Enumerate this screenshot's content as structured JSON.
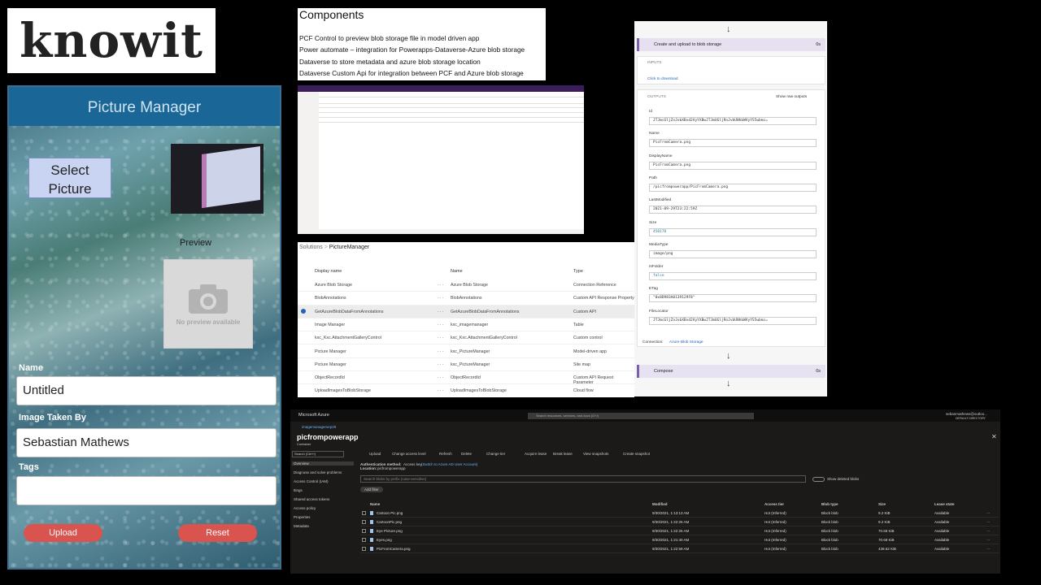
{
  "logo": {
    "text": "knowit"
  },
  "picture_manager": {
    "title": "Picture Manager",
    "select_button": "Select Picture",
    "preview_label": "Preview",
    "no_preview": "No preview available",
    "name_label": "Name",
    "name_value": "Untitled",
    "taken_by_label": "Image Taken By",
    "taken_by_value": "Sebastian Mathews",
    "tags_label": "Tags",
    "tags_value": "",
    "upload_button": "Upload",
    "reset_button": "Reset"
  },
  "components": {
    "title": "Components",
    "items": [
      "PCF Control to preview blob storage file in model driven app",
      "Power automate – integration for Powerapps-Dataverse-Azure blob storage",
      "Dataverse to store metadata and azure blob storage location",
      "Dataverse Custom Api for integration between PCF and Azure blob storage"
    ]
  },
  "solution": {
    "breadcrumb_root": "Solutions",
    "breadcrumb_current": "PictureManager",
    "headers": {
      "display": "Display name",
      "name": "Name",
      "type": "Type"
    },
    "rows": [
      {
        "display": "Azure Blob Storage",
        "name": "Azure Blob Storage",
        "type": "Connection Reference"
      },
      {
        "display": "BlobAnnotations",
        "name": "BlobAnnotations",
        "type": "Custom API Response Property"
      },
      {
        "display": "GetAzureBlobDataFromAnnotations",
        "name": "GetAzureBlobDataFromAnnotations",
        "type": "Custom API"
      },
      {
        "display": "Image Manager",
        "name": "kxc_imagemanager",
        "type": "Table"
      },
      {
        "display": "kxc_Kxc.AttachmentGalleryControl",
        "name": "kxc_Kxc.AttachmentGalleryControl",
        "type": "Custom control"
      },
      {
        "display": "Picture Manager",
        "name": "kxc_PictureManager",
        "type": "Model-driven app"
      },
      {
        "display": "Picture Manager",
        "name": "kxc_PictureManager",
        "type": "Site map"
      },
      {
        "display": "ObjectRecordId",
        "name": "ObjectRecordId",
        "type": "Custom API Request Parameter"
      },
      {
        "display": "UploadImagesToBlobStorage",
        "name": "UploadImagesToBlobStorage",
        "type": "Cloud flow"
      }
    ]
  },
  "flow": {
    "step_title": "Create and upload to blob storage",
    "step_time": "0s",
    "inputs_label": "INPUTS",
    "inputs_link": "Click to download",
    "outputs_label": "OUTPUTS",
    "show_raw": "Show raw outputs",
    "fields": [
      {
        "label": "Id",
        "value": "JTJmcGljZnJvbXBvd2VyYXBwJTJmUGljRnJvbUNhbWVyYS5wbmc="
      },
      {
        "label": "Name",
        "value": "PicFromCamera.png"
      },
      {
        "label": "DisplayName",
        "value": "PicFromCamera.png"
      },
      {
        "label": "Path",
        "value": "/picfrompowerapp/PicFromCamera.png"
      },
      {
        "label": "LastModified",
        "value": "2021-09-29T23:22:59Z"
      },
      {
        "label": "Size",
        "value": "450178"
      },
      {
        "label": "MediaType",
        "value": "image/png"
      },
      {
        "label": "IsFolder",
        "value": "false"
      },
      {
        "label": "ETag",
        "value": "\"0x8D983A0139129F8\""
      },
      {
        "label": "FileLocator",
        "value": "JTJmcGljZnJvbXBvd2VyYXBwJTJmUGljRnJvbUNhbWVyYS5wbmc="
      }
    ],
    "connection_label": "Connection:",
    "connection_value": "Azure Blob Storage",
    "compose_title": "Compose",
    "compose_time": "0s"
  },
  "azure": {
    "brand": "Microsoft Azure",
    "search_placeholder": "Search resources, services, and docs (G+/)",
    "user": "sebanmathews@outloo...",
    "directory": "DEFAULT DIRECTORY",
    "breadcrumb": "imagemanagersep29",
    "container_name": "picfrompowerapp",
    "container_sub": "Container",
    "search_left": "Search (Ctrl+/)",
    "toolbar": [
      "Upload",
      "Change access level",
      "Refresh",
      "Delete",
      "Change tier",
      "Acquire lease",
      "Break lease",
      "View snapshots",
      "Create snapshot"
    ],
    "nav": [
      "Overview",
      "Diagnose and solve problems",
      "Access Control (IAM)",
      "ttings",
      "Shared access tokens",
      "Access policy",
      "Properties",
      "Metadata"
    ],
    "auth_label": "Authentication method:",
    "auth_value": "Access key",
    "auth_link": "(Switch to Azure AD User Account)",
    "location_label": "Location:",
    "location_value": "picfrompowerapp",
    "blob_search": "Search blobs by prefix (case-sensitive)",
    "show_deleted": "Show deleted blobs",
    "add_filter": "Add filter",
    "columns": [
      "Name",
      "Modified",
      "Access tier",
      "Blob type",
      "Size",
      "Lease state"
    ],
    "blobs": [
      {
        "name": "Cartoon Pic.png",
        "modified": "9/30/2021, 1:13:13 AM",
        "tier": "Hot (Inferred)",
        "type": "Block blob",
        "size": "9.2 KiB",
        "lease": "Available"
      },
      {
        "name": "CartoonPic.png",
        "modified": "9/30/2021, 1:22:26 AM",
        "tier": "Hot (Inferred)",
        "type": "Block blob",
        "size": "9.2 KiB",
        "lease": "Available"
      },
      {
        "name": "Eye Picture.png",
        "modified": "9/30/2021, 1:22:26 AM",
        "tier": "Hot (Inferred)",
        "type": "Block blob",
        "size": "70.68 KiB",
        "lease": "Available"
      },
      {
        "name": "Eyes.png",
        "modified": "9/30/2021, 1:21:40 AM",
        "tier": "Hot (Inferred)",
        "type": "Block blob",
        "size": "70.68 KiB",
        "lease": "Available"
      },
      {
        "name": "PicFromCamera.png",
        "modified": "9/30/2021, 1:22:59 AM",
        "tier": "Hot (Inferred)",
        "type": "Block blob",
        "size": "439.62 KiB",
        "lease": "Available"
      }
    ]
  }
}
